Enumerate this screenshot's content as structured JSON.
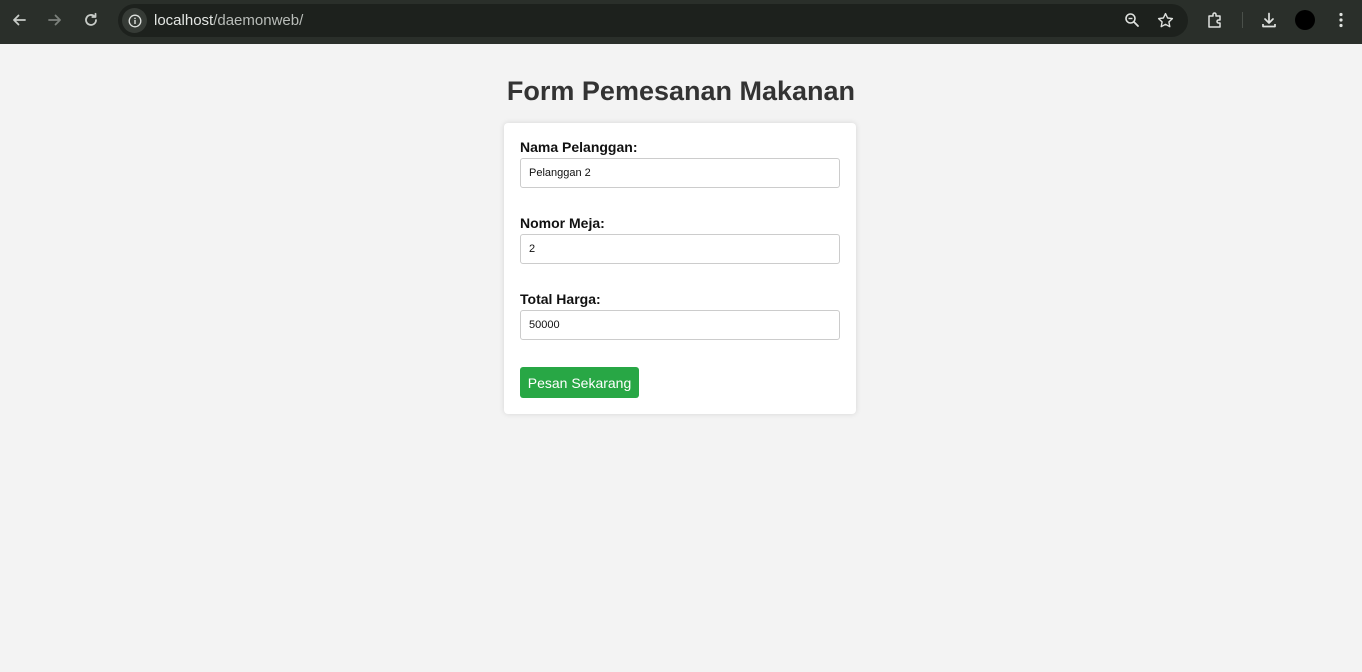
{
  "browser": {
    "url_host": "localhost",
    "url_path": "/daemonweb/",
    "icons": [
      "back-arrow-icon",
      "forward-arrow-icon",
      "reload-icon",
      "info-icon",
      "zoom-icon",
      "star-icon",
      "extensions-icon",
      "download-icon",
      "menu-icon"
    ]
  },
  "page": {
    "title": "Form Pemesanan Makanan"
  },
  "form": {
    "fields": [
      {
        "label": "Nama Pelanggan:",
        "value": "Pelanggan 2"
      },
      {
        "label": "Nomor Meja:",
        "value": "2"
      },
      {
        "label": "Total Harga:",
        "value": "50000"
      }
    ],
    "submit_label": "Pesan Sekarang",
    "submit_color": "#28a745"
  }
}
